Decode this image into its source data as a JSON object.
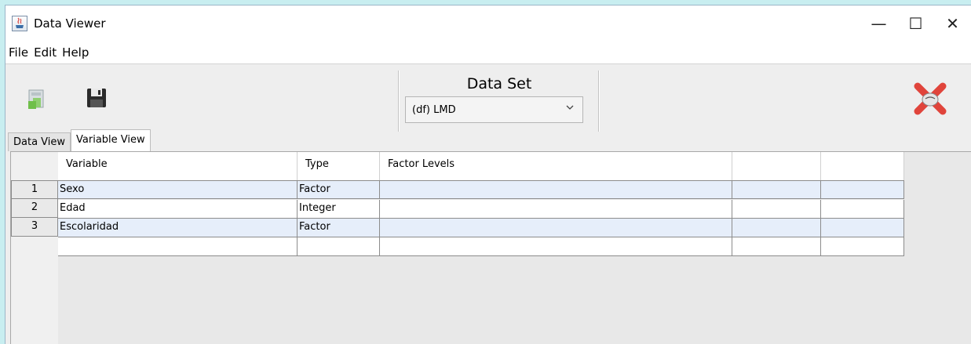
{
  "window": {
    "title": "Data Viewer",
    "icon": "java-icon"
  },
  "window_controls": {
    "minimize": "—",
    "maximize": "☐",
    "close": "✕"
  },
  "menu": [
    "File",
    "Edit",
    "Help"
  ],
  "toolbar": {
    "dataset_label": "Data Set",
    "dataset_selected": "(df) LMD",
    "icons": [
      "load-data-icon",
      "save-icon",
      "close-data-icon"
    ]
  },
  "tabs": [
    {
      "label": "Data View",
      "active": false
    },
    {
      "label": "Variable View",
      "active": true
    }
  ],
  "table": {
    "columns": [
      "Variable",
      "Type",
      "Factor Levels",
      "",
      ""
    ],
    "rows": [
      {
        "num": "1",
        "cells": [
          "Sexo",
          "Factor",
          "",
          "",
          ""
        ]
      },
      {
        "num": "2",
        "cells": [
          "Edad",
          "Integer",
          "",
          "",
          ""
        ]
      },
      {
        "num": "3",
        "cells": [
          "Escolaridad",
          "Factor",
          "",
          "",
          ""
        ]
      }
    ]
  }
}
